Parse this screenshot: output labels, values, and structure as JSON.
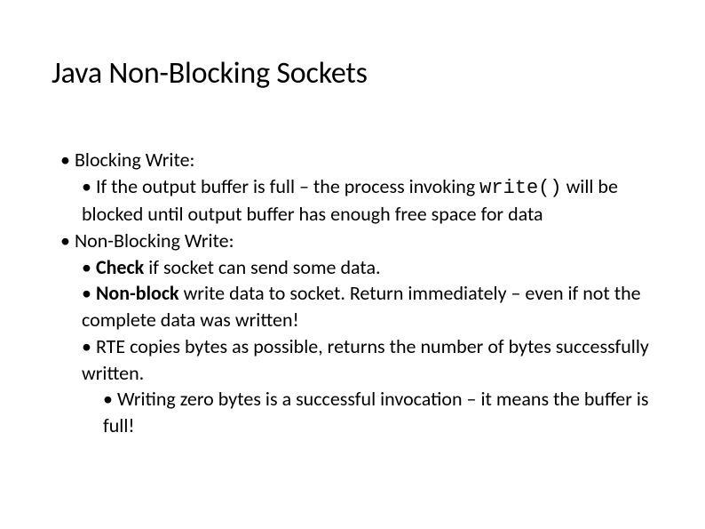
{
  "title": "Java Non-Blocking Sockets",
  "b1_label": "Blocking Write:",
  "b1_sub_pre": "If the output buffer is full – the process invoking ",
  "b1_sub_code": "write()",
  "b1_sub_post": " will be blocked until output buffer has enough free space for data",
  "b2_label": "Non-Blocking Write:",
  "b2_s1_bold": "Check",
  "b2_s1_rest": " if socket can send some data.",
  "b2_s2_bold": "Non-block",
  "b2_s2_rest": " write data to socket. Return immediately – even if not the complete data was written!",
  "b2_s3": "RTE copies bytes as possible, returns the number of bytes successfully written.",
  "b2_s3_sub": "Writing zero bytes is a successful invocation – it means the buffer is full!"
}
